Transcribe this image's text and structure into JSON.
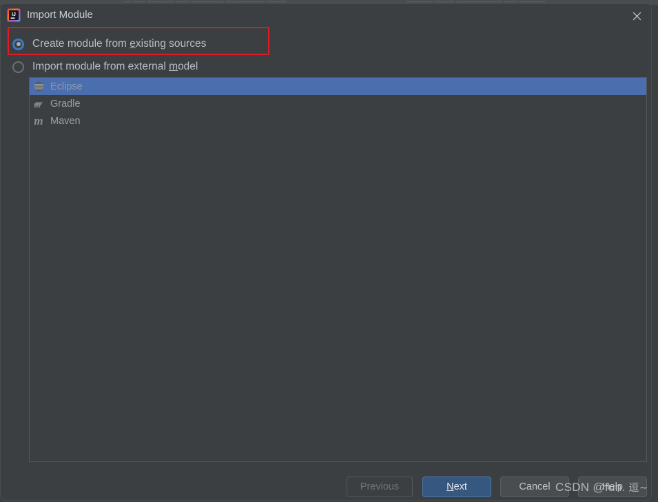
{
  "background": {
    "strip_fragments": [
      "— —— ————  ——  —————  —————— ———",
      "————  ———  ———————  ——  ————"
    ]
  },
  "titlebar": {
    "title": "Import Module",
    "app_icon": "intellij-idea-icon",
    "close_icon": "close-icon"
  },
  "options": {
    "existing_sources": {
      "label_before": "Create module from ",
      "mnemonic": "e",
      "label_after": "xisting sources",
      "selected": true
    },
    "external_model": {
      "label_before": "Import module from external ",
      "mnemonic": "m",
      "label_after": "odel",
      "selected": false
    }
  },
  "annotation": {
    "color": "#e01b24"
  },
  "model_list": {
    "items": [
      {
        "label": "Eclipse",
        "icon": "eclipse-icon",
        "selected": true
      },
      {
        "label": "Gradle",
        "icon": "gradle-elephant-icon",
        "selected": false
      },
      {
        "label": "Maven",
        "icon": "maven-icon",
        "selected": false
      }
    ]
  },
  "footer": {
    "previous": {
      "label": "Previous",
      "enabled": false
    },
    "next": {
      "label_before": "",
      "mnemonic": "N",
      "label_after": "ext",
      "primary": true
    },
    "cancel": {
      "label": "Cancel"
    },
    "help": {
      "label": "Help"
    }
  },
  "watermark": {
    "text": "CSDN @fun.",
    "cjk": "逗~"
  },
  "colors": {
    "dialog_bg": "#3c3f41",
    "selection_blue": "#4b6eaf",
    "primary_button": "#365880",
    "annotation_red": "#e01b24",
    "radio_accent": "#3c79bd"
  }
}
